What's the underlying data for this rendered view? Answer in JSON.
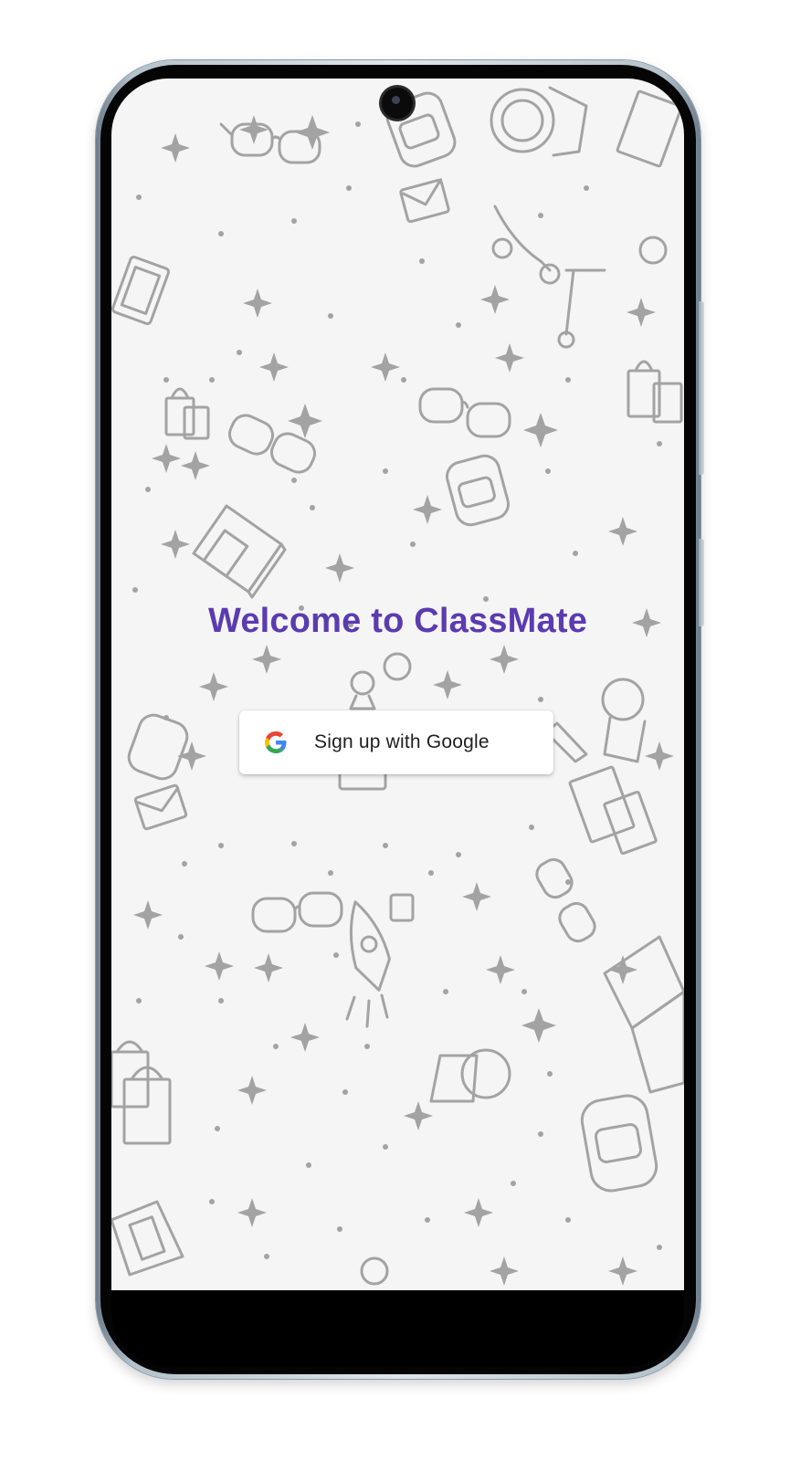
{
  "app": {
    "name": "ClassMate"
  },
  "login": {
    "welcome_title": "Welcome to ClassMate",
    "google_button_label": "Sign up with Google",
    "google_icon": "google-g-icon"
  },
  "colors": {
    "title": "#5b3bb0",
    "screen_background": "#f5f5f5",
    "button_background": "#ffffff",
    "pattern": "#9a9a9a"
  }
}
